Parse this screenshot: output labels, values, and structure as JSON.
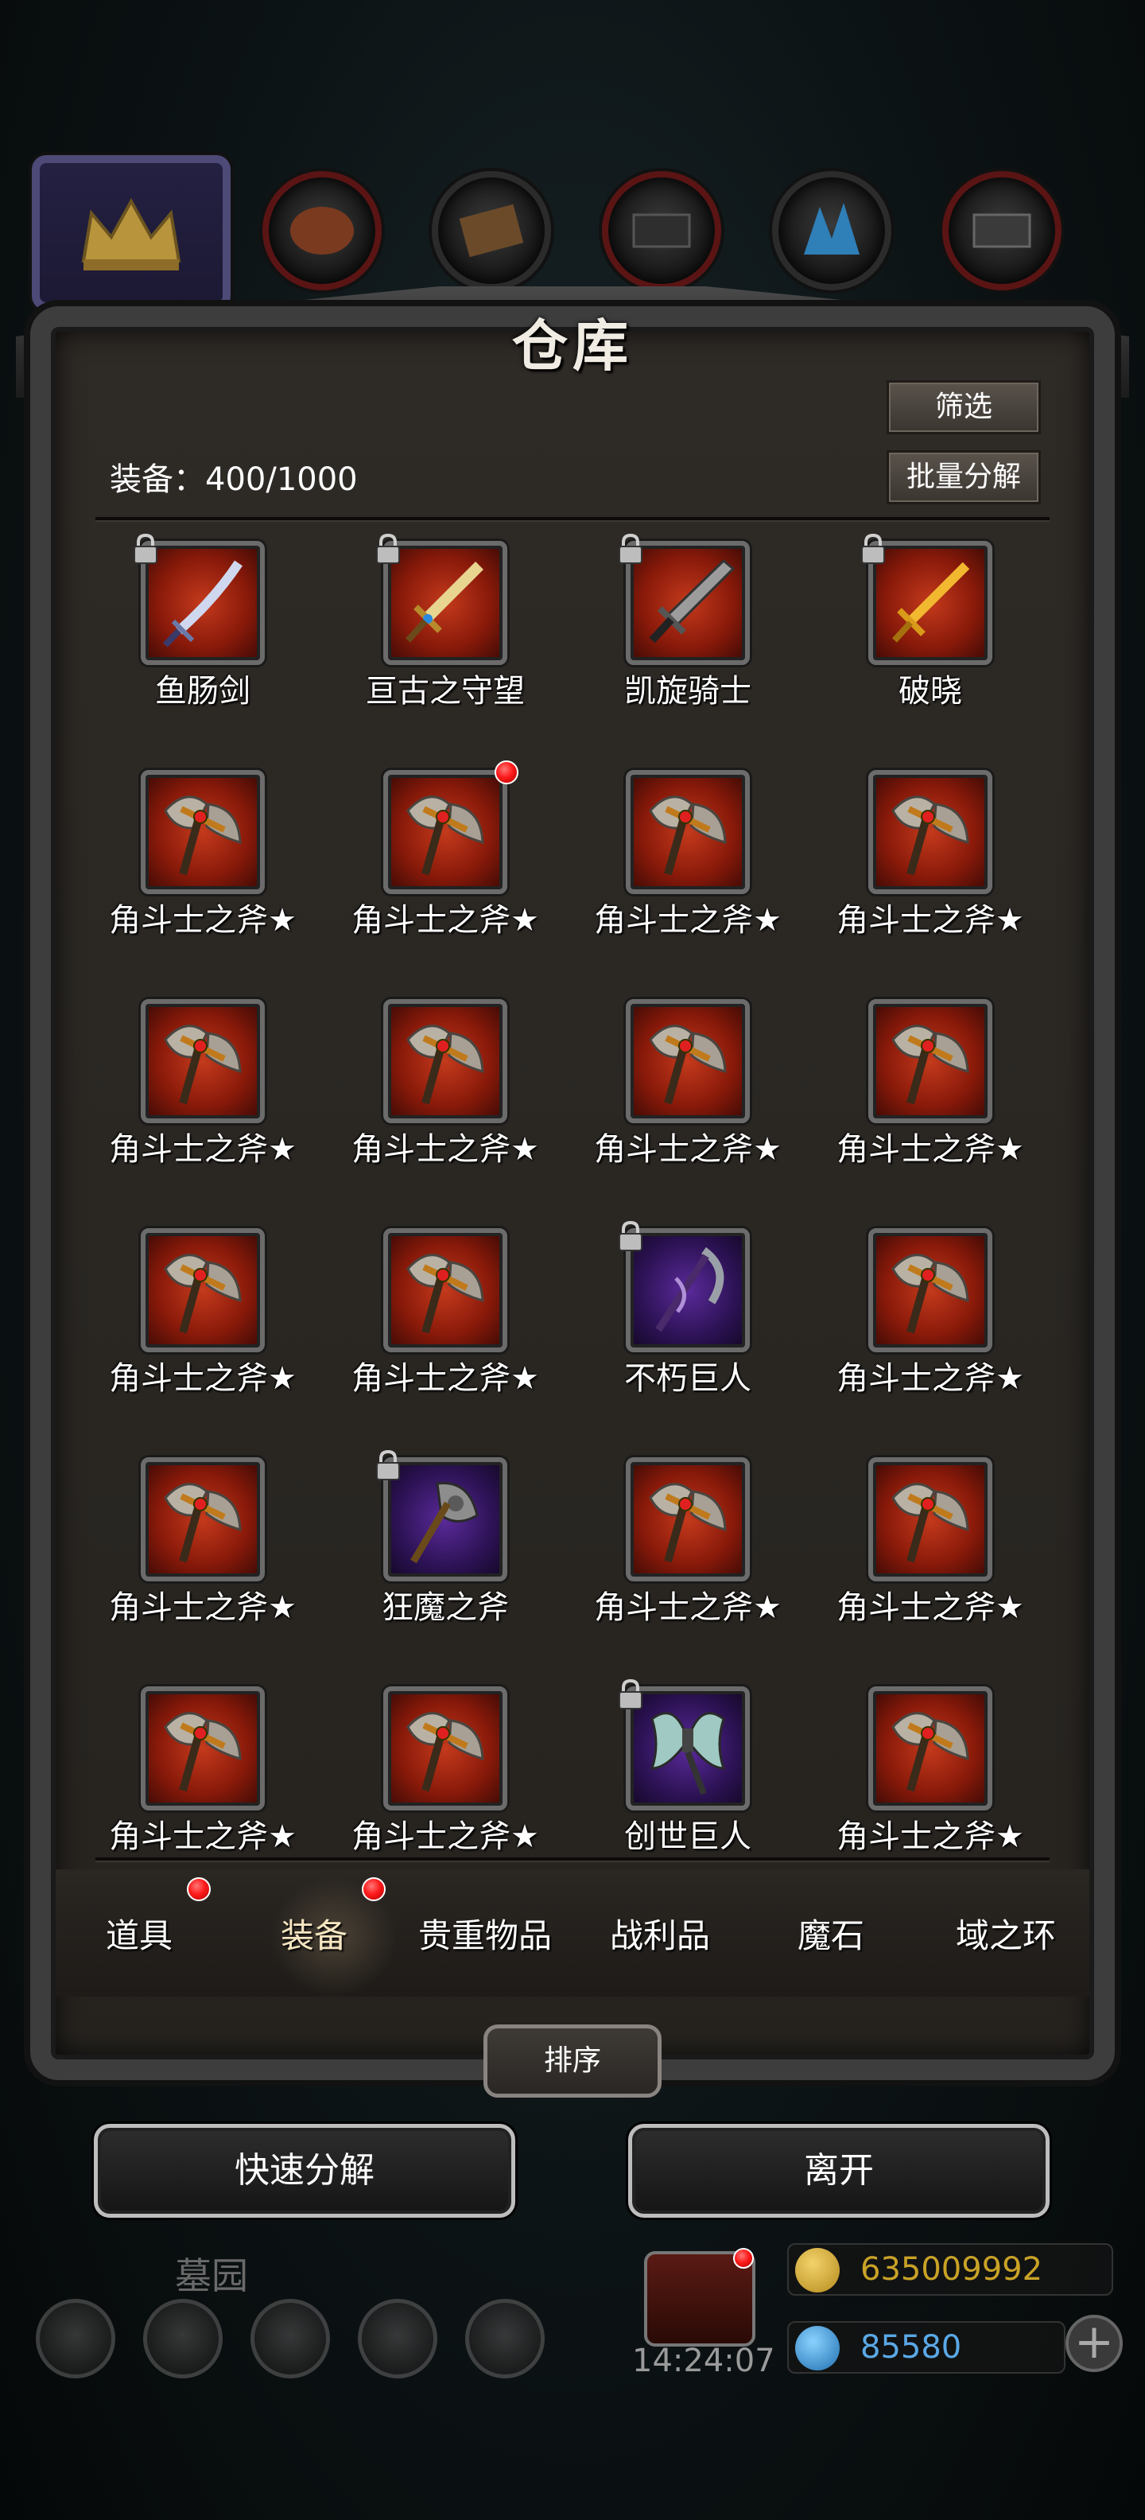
{
  "window": {
    "title": "仓库"
  },
  "toolbar": {
    "filter_label": "筛选",
    "batch_disassemble_label": "批量分解"
  },
  "capacity": {
    "text": "装备：400/1000"
  },
  "items": [
    {
      "name": "鱼肠剑",
      "locked": true,
      "badge": false,
      "frame": "red",
      "icon": "sword-curved-icon"
    },
    {
      "name": "亘古之守望",
      "locked": true,
      "badge": false,
      "frame": "red",
      "icon": "sword-ornate-icon"
    },
    {
      "name": "凯旋骑士",
      "locked": true,
      "badge": false,
      "frame": "red",
      "icon": "greatsword-icon"
    },
    {
      "name": "破晓",
      "locked": true,
      "badge": false,
      "frame": "red",
      "icon": "golden-sword-icon"
    },
    {
      "name": "角斗士之斧★",
      "locked": false,
      "badge": false,
      "frame": "red",
      "icon": "battle-axe-icon"
    },
    {
      "name": "角斗士之斧★",
      "locked": false,
      "badge": true,
      "frame": "red",
      "icon": "battle-axe-icon"
    },
    {
      "name": "角斗士之斧★",
      "locked": false,
      "badge": false,
      "frame": "red",
      "icon": "battle-axe-icon"
    },
    {
      "name": "角斗士之斧★",
      "locked": false,
      "badge": false,
      "frame": "red",
      "icon": "battle-axe-icon"
    },
    {
      "name": "角斗士之斧★",
      "locked": false,
      "badge": false,
      "frame": "red",
      "icon": "battle-axe-icon"
    },
    {
      "name": "角斗士之斧★",
      "locked": false,
      "badge": false,
      "frame": "red",
      "icon": "battle-axe-icon"
    },
    {
      "name": "角斗士之斧★",
      "locked": false,
      "badge": false,
      "frame": "red",
      "icon": "battle-axe-icon"
    },
    {
      "name": "角斗士之斧★",
      "locked": false,
      "badge": false,
      "frame": "red",
      "icon": "battle-axe-icon"
    },
    {
      "name": "角斗士之斧★",
      "locked": false,
      "badge": false,
      "frame": "red",
      "icon": "battle-axe-icon"
    },
    {
      "name": "角斗士之斧★",
      "locked": false,
      "badge": false,
      "frame": "red",
      "icon": "battle-axe-icon"
    },
    {
      "name": "不朽巨人",
      "locked": true,
      "badge": false,
      "frame": "purple",
      "icon": "dark-scythe-icon"
    },
    {
      "name": "角斗士之斧★",
      "locked": false,
      "badge": false,
      "frame": "red",
      "icon": "battle-axe-icon"
    },
    {
      "name": "角斗士之斧★",
      "locked": false,
      "badge": false,
      "frame": "red",
      "icon": "battle-axe-icon"
    },
    {
      "name": "狂魔之斧",
      "locked": true,
      "badge": false,
      "frame": "purple",
      "icon": "demon-axe-icon"
    },
    {
      "name": "角斗士之斧★",
      "locked": false,
      "badge": false,
      "frame": "red",
      "icon": "battle-axe-icon"
    },
    {
      "name": "角斗士之斧★",
      "locked": false,
      "badge": false,
      "frame": "red",
      "icon": "battle-axe-icon"
    },
    {
      "name": "角斗士之斧★",
      "locked": false,
      "badge": false,
      "frame": "red",
      "icon": "battle-axe-icon"
    },
    {
      "name": "角斗士之斧★",
      "locked": false,
      "badge": false,
      "frame": "red",
      "icon": "battle-axe-icon"
    },
    {
      "name": "创世巨人",
      "locked": true,
      "badge": false,
      "frame": "purple",
      "icon": "jade-axe-icon"
    },
    {
      "name": "角斗士之斧★",
      "locked": false,
      "badge": false,
      "frame": "red",
      "icon": "battle-axe-icon"
    }
  ],
  "tabs": [
    {
      "label": "道具",
      "badge": true,
      "active": false
    },
    {
      "label": "装备",
      "badge": true,
      "active": true
    },
    {
      "label": "贵重物品",
      "badge": false,
      "active": false
    },
    {
      "label": "战利品",
      "badge": false,
      "active": false
    },
    {
      "label": "魔石",
      "badge": false,
      "active": false
    },
    {
      "label": "域之环",
      "badge": false,
      "active": false
    }
  ],
  "sort": {
    "label": "排序"
  },
  "actions": {
    "quick_disassemble_label": "快速分解",
    "leave_label": "离开"
  },
  "background": {
    "location_label": "墓园",
    "timer": "14:24:07",
    "gold": "635009992",
    "gems": "85580"
  },
  "colors": {
    "item_frame_red": "#8a1a0a",
    "item_frame_purple": "#2c1254",
    "badge_red": "#ff1b1b",
    "gold_text": "#c9a227",
    "gem_text": "#5aa8e6"
  }
}
